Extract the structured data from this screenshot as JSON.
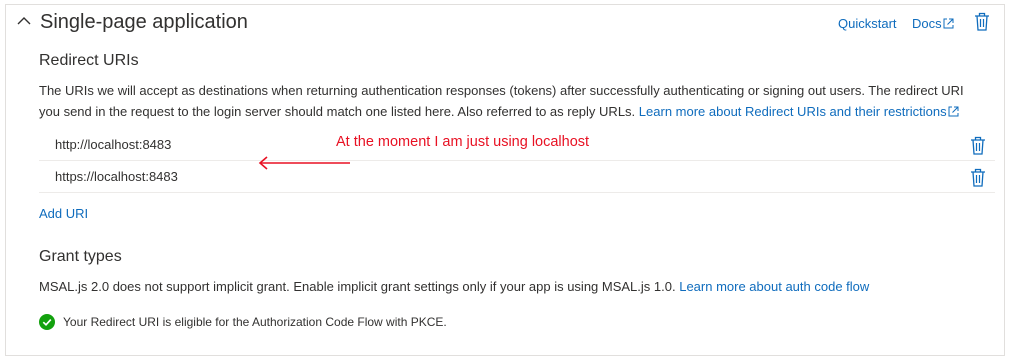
{
  "section": {
    "title": "Single-page application",
    "quickstart_label": "Quickstart",
    "docs_label": "Docs"
  },
  "redirect": {
    "heading": "Redirect URIs",
    "description": "The URIs we will accept as destinations when returning authentication responses (tokens) after successfully authenticating or signing out users. The redirect URI you send in the request to the login server should match one listed here. Also referred to as reply URLs.",
    "learn_more": "Learn more about Redirect URIs and their restrictions",
    "uris": [
      "http://localhost:8483",
      "https://localhost:8483"
    ],
    "add_label": "Add URI"
  },
  "annotation": "At the moment I am just using localhost",
  "grant": {
    "heading": "Grant types",
    "description": "MSAL.js 2.0 does not support implicit grant. Enable implicit grant settings only if your app is using MSAL.js 1.0.",
    "learn_more": "Learn more about auth code flow",
    "status": "Your Redirect URI is eligible for the Authorization Code Flow with PKCE."
  },
  "colors": {
    "link": "#0f6cbd",
    "annotation": "#e81123",
    "success": "#13a10e"
  },
  "icons": [
    "chevron-up-icon",
    "external-link-icon",
    "trash-icon",
    "arrow-left-icon",
    "checkmark-circle-icon"
  ]
}
